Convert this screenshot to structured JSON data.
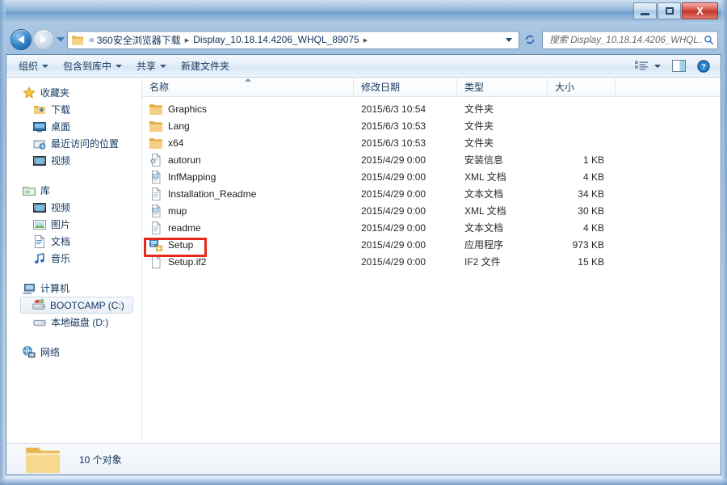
{
  "window": {
    "title": "",
    "buttons": {
      "minimize": "—",
      "maximize": "□",
      "close": "X"
    }
  },
  "address_bar": {
    "back_tooltip": "后退",
    "forward_tooltip": "前进",
    "overflow": "«",
    "crumbs": [
      "360安全浏览器下载",
      "Display_10.18.14.4206_WHQL_89075"
    ],
    "separator": "▸",
    "refresh_icon": "↻"
  },
  "search": {
    "placeholder": "搜索 Display_10.18.14.4206_WHQL...",
    "value": "",
    "icon": "search-icon"
  },
  "command_bar": {
    "items": [
      {
        "label": "组织",
        "has_caret": true
      },
      {
        "label": "包含到库中",
        "has_caret": true
      },
      {
        "label": "共享",
        "has_caret": true
      },
      {
        "label": "新建文件夹",
        "has_caret": false
      }
    ],
    "view_icon": "view-list-icon",
    "preview_icon": "preview-pane-icon",
    "help_icon": "help-icon"
  },
  "sidebar": {
    "groups": [
      {
        "header": {
          "label": "收藏夹",
          "icon": "star-icon"
        },
        "items": [
          {
            "label": "下载",
            "icon": "downloads-icon"
          },
          {
            "label": "桌面",
            "icon": "desktop-icon"
          },
          {
            "label": "最近访问的位置",
            "icon": "recent-places-icon"
          },
          {
            "label": "视频",
            "icon": "video-icon"
          }
        ]
      },
      {
        "header": {
          "label": "库",
          "icon": "library-icon"
        },
        "items": [
          {
            "label": "视频",
            "icon": "video-icon"
          },
          {
            "label": "图片",
            "icon": "pictures-icon"
          },
          {
            "label": "文档",
            "icon": "documents-icon"
          },
          {
            "label": "音乐",
            "icon": "music-icon"
          }
        ]
      },
      {
        "header": {
          "label": "计算机",
          "icon": "computer-icon"
        },
        "items": [
          {
            "label": "BOOTCAMP (C:)",
            "icon": "system-drive-icon",
            "selected": true
          },
          {
            "label": "本地磁盘 (D:)",
            "icon": "drive-icon"
          }
        ]
      },
      {
        "header": {
          "label": "网络",
          "icon": "network-icon"
        },
        "items": []
      }
    ]
  },
  "file_list": {
    "columns": [
      {
        "key": "name",
        "label": "名称",
        "sorted": "asc"
      },
      {
        "key": "date",
        "label": "修改日期"
      },
      {
        "key": "type",
        "label": "类型"
      },
      {
        "key": "size",
        "label": "大小"
      }
    ],
    "rows": [
      {
        "name": "Graphics",
        "date": "2015/6/3 10:54",
        "type": "文件夹",
        "size": "",
        "icon": "folder-icon"
      },
      {
        "name": "Lang",
        "date": "2015/6/3 10:53",
        "type": "文件夹",
        "size": "",
        "icon": "folder-icon"
      },
      {
        "name": "x64",
        "date": "2015/6/3 10:53",
        "type": "文件夹",
        "size": "",
        "icon": "folder-icon"
      },
      {
        "name": "autorun",
        "date": "2015/4/29 0:00",
        "type": "安装信息",
        "size": "1 KB",
        "icon": "setup-information-icon"
      },
      {
        "name": "InfMapping",
        "date": "2015/4/29 0:00",
        "type": "XML 文档",
        "size": "4 KB",
        "icon": "xml-document-icon"
      },
      {
        "name": "Installation_Readme",
        "date": "2015/4/29 0:00",
        "type": "文本文档",
        "size": "34 KB",
        "icon": "text-document-icon"
      },
      {
        "name": "mup",
        "date": "2015/4/29 0:00",
        "type": "XML 文档",
        "size": "30 KB",
        "icon": "xml-document-icon"
      },
      {
        "name": "readme",
        "date": "2015/4/29 0:00",
        "type": "文本文档",
        "size": "4 KB",
        "icon": "text-document-icon"
      },
      {
        "name": "Setup",
        "date": "2015/4/29 0:00",
        "type": "应用程序",
        "size": "973 KB",
        "icon": "application-icon",
        "highlighted": true
      },
      {
        "name": "Setup.if2",
        "date": "2015/4/29 0:00",
        "type": "IF2 文件",
        "size": "15 KB",
        "icon": "generic-file-icon"
      }
    ]
  },
  "status_bar": {
    "count_text": "10 个对象",
    "icon": "folder-large-icon"
  },
  "colors": {
    "accent": "#2f7fc4",
    "annotation": "#e8271b",
    "title_blue": "#7fa9d4",
    "close_red": "#c0392b",
    "folder_yellow": "#f5c453"
  }
}
